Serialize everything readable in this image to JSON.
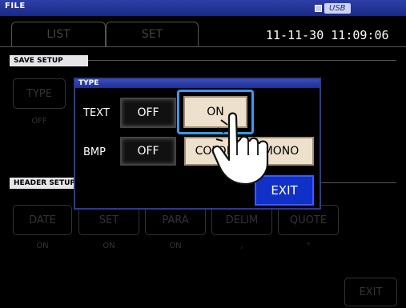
{
  "topbar": {
    "title": "FILE",
    "usb_label": "USB"
  },
  "tabs": [
    {
      "label": "LIST"
    },
    {
      "label": "SET"
    }
  ],
  "clock": "11-11-30 11:09:06",
  "save_setup": {
    "title": "SAVE SETUP",
    "type_button": "TYPE",
    "type_value": "OFF"
  },
  "header_setup": {
    "title": "HEADER SETUP",
    "buttons": [
      {
        "label": "DATE",
        "value": "ON"
      },
      {
        "label": "SET",
        "value": "ON"
      },
      {
        "label": "PARA",
        "value": "ON"
      },
      {
        "label": "DELIM",
        "value": ","
      },
      {
        "label": "QUOTE",
        "value": "\""
      }
    ]
  },
  "exit_label": "EXIT",
  "dialog": {
    "title": "TYPE",
    "text_label": "TEXT",
    "text_off": "OFF",
    "text_on": "ON",
    "bmp_label": "BMP",
    "bmp_off": "OFF",
    "bmp_color": "COLOR",
    "bmp_mono": "MONO",
    "exit": "EXIT"
  },
  "colors": {
    "accent": "#1030c8",
    "titlebar": "#1f2f90",
    "option": "#ede0cc",
    "focus": "#3a9ae8"
  }
}
